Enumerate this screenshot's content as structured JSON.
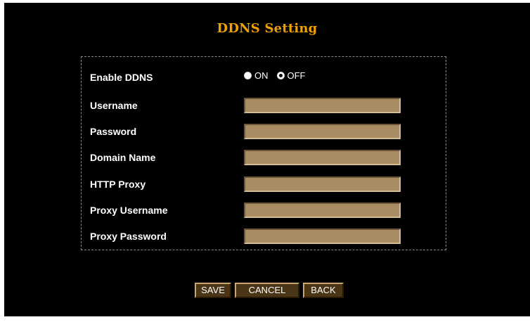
{
  "page": {
    "title": "DDNS Setting"
  },
  "form": {
    "enable_ddns": {
      "label": "Enable DDNS",
      "options": [
        {
          "label": "ON",
          "checked": false
        },
        {
          "label": "OFF",
          "checked": true
        }
      ]
    },
    "fields": [
      {
        "label": "Username",
        "value": ""
      },
      {
        "label": "Password",
        "value": ""
      },
      {
        "label": "Domain Name",
        "value": ""
      },
      {
        "label": "HTTP Proxy",
        "value": ""
      },
      {
        "label": "Proxy Username",
        "value": ""
      },
      {
        "label": "Proxy Password",
        "value": ""
      }
    ]
  },
  "buttons": {
    "save": "SAVE",
    "cancel": "CANCEL",
    "back": "BACK"
  },
  "colors": {
    "background": "#000000",
    "title": "#f0a000",
    "input_fill": "#a88c64",
    "button_fill": "#4a3516"
  }
}
